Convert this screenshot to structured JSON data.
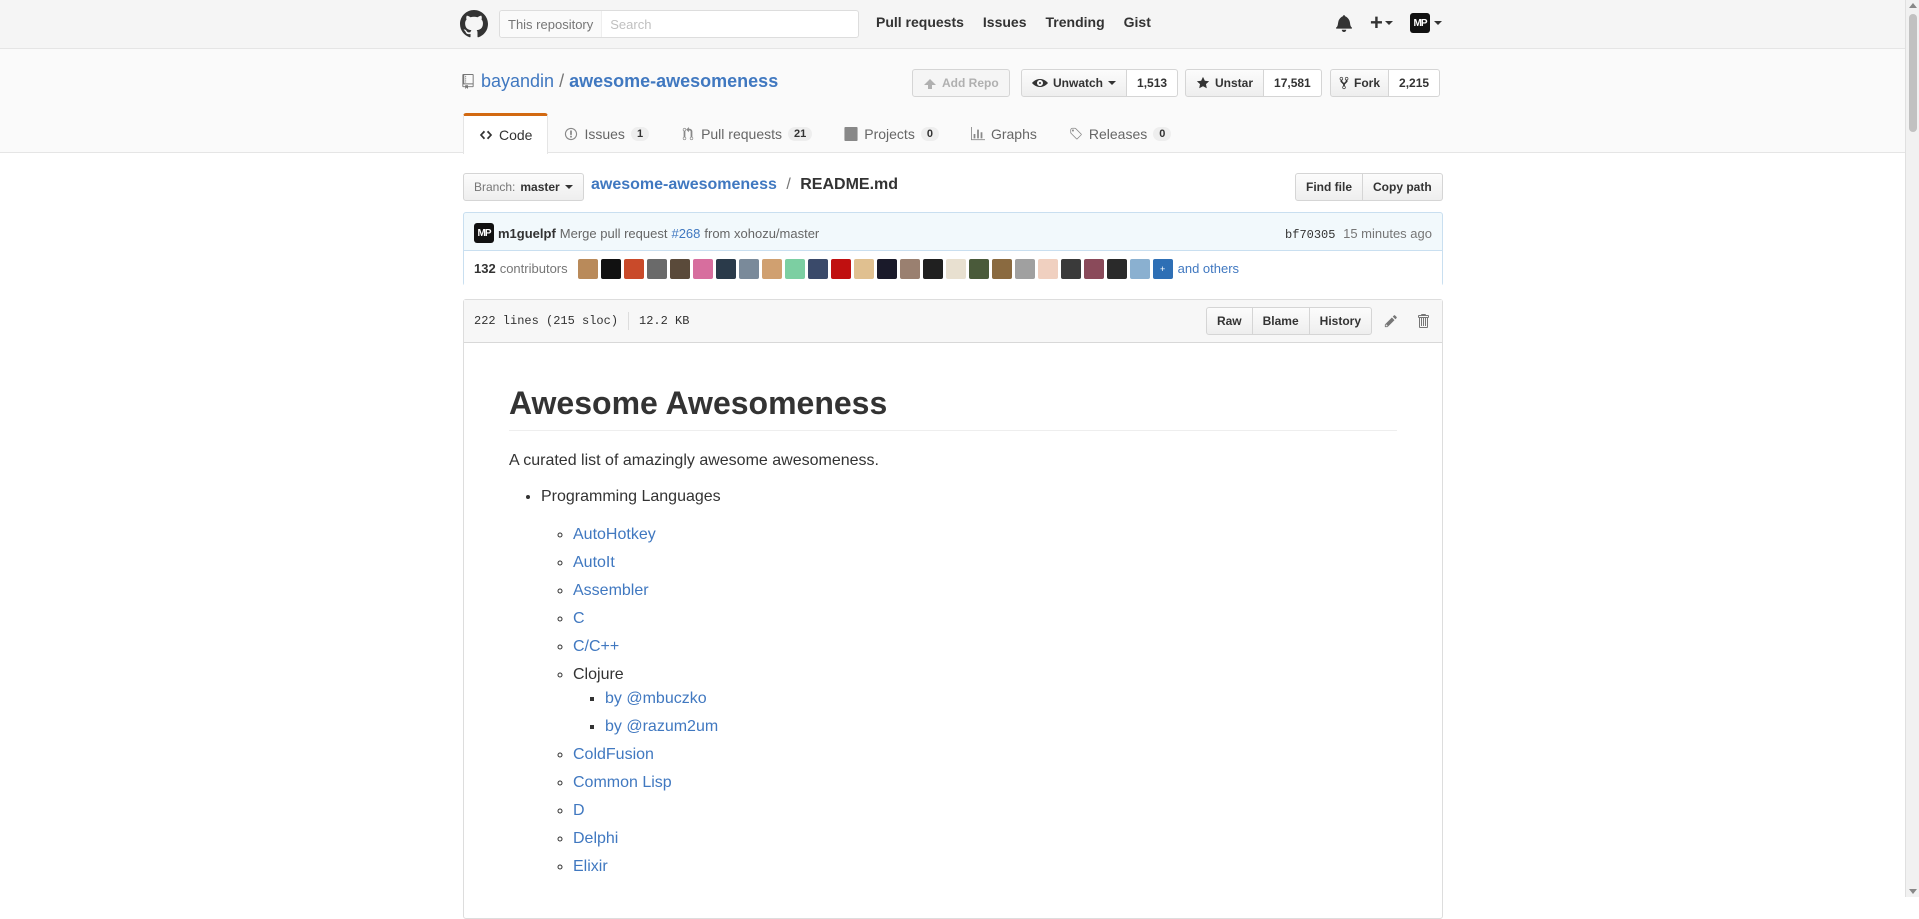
{
  "header": {
    "search_scope": "This repository",
    "search_placeholder": "Search",
    "nav": [
      "Pull requests",
      "Issues",
      "Trending",
      "Gist"
    ],
    "avatar_text": "MP"
  },
  "repo": {
    "owner": "bayandin",
    "separator": "/",
    "name": "awesome-awesomeness",
    "add_repo_label": "Add Repo",
    "watch_label": "Unwatch",
    "watch_count": "1,513",
    "star_label": "Unstar",
    "star_count": "17,581",
    "fork_label": "Fork",
    "fork_count": "2,215"
  },
  "tabs": [
    {
      "label": "Code",
      "count": "",
      "icon": "code-icon",
      "selected": true
    },
    {
      "label": "Issues",
      "count": "1",
      "icon": "issue-icon"
    },
    {
      "label": "Pull requests",
      "count": "21",
      "icon": "pull-request-icon"
    },
    {
      "label": "Projects",
      "count": "0",
      "icon": "project-icon"
    },
    {
      "label": "Graphs",
      "count": "",
      "icon": "graph-icon"
    },
    {
      "label": "Releases",
      "count": "0",
      "icon": "tag-icon"
    }
  ],
  "file_nav": {
    "branch_prefix": "Branch:",
    "branch_name": "master",
    "path_root": "awesome-awesomeness",
    "path_sep": "/",
    "file_name": "README.md",
    "find_file_label": "Find file",
    "copy_path_label": "Copy path"
  },
  "commit": {
    "author": "m1guelpf",
    "message_prefix": "Merge pull request",
    "pr_link": "#268",
    "message_suffix": "from xohozu/master",
    "sha": "bf70305",
    "time": "15 minutes ago",
    "contributors_count": "132",
    "contributors_label": "contributors",
    "more_label": "+",
    "others_label": "and others"
  },
  "file": {
    "lines": "222 lines (215 sloc)",
    "size": "12.2 KB",
    "raw_label": "Raw",
    "blame_label": "Blame",
    "history_label": "History"
  },
  "readme": {
    "title": "Awesome Awesomeness",
    "description": "A curated list of amazingly awesome awesomeness.",
    "section": "Programming Languages",
    "items": [
      {
        "text": "AutoHotkey",
        "link": true
      },
      {
        "text": "AutoIt",
        "link": true
      },
      {
        "text": "Assembler",
        "link": true
      },
      {
        "text": "C",
        "link": true
      },
      {
        "text": "C/C++",
        "link": true
      },
      {
        "text": "Clojure",
        "link": false,
        "children": [
          "by @mbuczko",
          "by @razum2um"
        ]
      },
      {
        "text": "ColdFusion",
        "link": true
      },
      {
        "text": "Common Lisp",
        "link": true
      },
      {
        "text": "D",
        "link": true
      },
      {
        "text": "Delphi",
        "link": true
      },
      {
        "text": "Elixir",
        "link": true
      }
    ]
  },
  "colors": {
    "link": "#4078c0",
    "tab_accent": "#d26911",
    "commit_bg": "#f2f9fc"
  }
}
